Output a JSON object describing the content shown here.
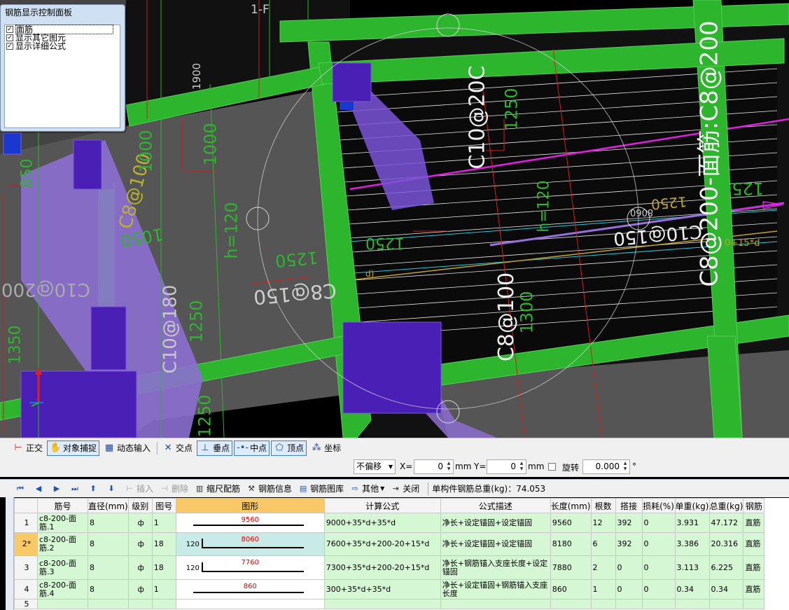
{
  "panel": {
    "title": "钢筋显示控制面板",
    "items": [
      {
        "label": "面筋",
        "checked": true
      },
      {
        "label": "显示其它图元",
        "checked": true
      },
      {
        "label": "显示详细公式",
        "checked": true
      }
    ]
  },
  "cad": {
    "labels": [
      "1-F",
      "1900",
      "C10@20C",
      "1250",
      "C8@200-面筋:C8@200",
      "1250",
      "850",
      "C8@100",
      "1000",
      "1000",
      "h=120",
      "1050",
      "1250",
      "C8@150",
      "C10@200",
      "C10@180",
      "1250",
      "1350",
      "1250",
      "h=120",
      "1250",
      "C10@150",
      "C8@100",
      "1300",
      "8060",
      "1250",
      "0+15*d",
      "d)"
    ]
  },
  "snapbar": {
    "buttons": [
      {
        "label": "正交",
        "icon": "ortho-icon",
        "on": false
      },
      {
        "label": "对象捕捉",
        "icon": "object-snap-icon",
        "on": true
      },
      {
        "label": "动态输入",
        "icon": "dynamic-input-icon",
        "on": false
      },
      {
        "label": "交点",
        "icon": "intersection-icon",
        "on": false
      },
      {
        "label": "垂点",
        "icon": "perpendicular-icon",
        "on": true
      },
      {
        "label": "中点",
        "icon": "midpoint-icon",
        "on": true
      },
      {
        "label": "顶点",
        "icon": "vertex-icon",
        "on": true
      },
      {
        "label": "坐标",
        "icon": "coordinate-icon",
        "on": false
      }
    ]
  },
  "coordbar": {
    "offset_mode": "不偏移",
    "x_label": "X=",
    "x_value": "0",
    "mm1": "mm",
    "y_label": "Y=",
    "y_value": "0",
    "mm2": "mm",
    "rotate_label": "旋转",
    "rotate_value": "0.000",
    "degree": "°"
  },
  "rebarbar": {
    "insert": "插入",
    "delete": "删除",
    "scale": "缩尺配筋",
    "info": "钢筋信息",
    "library": "钢筋图库",
    "other": "其他",
    "close": "关闭",
    "total": "单构件钢筋总重(kg)：74.053"
  },
  "table": {
    "headers": [
      "",
      "筋号",
      "直径(mm)",
      "级别",
      "图号",
      "图形",
      "计算公式",
      "公式描述",
      "长度(mm)",
      "根数",
      "搭接",
      "损耗(%)",
      "单重(kg)",
      "总重(kg)",
      "钢筋"
    ],
    "rows": [
      {
        "rn": "1",
        "name": "c8-200-面筋.1",
        "dia": "8",
        "grade": "ф",
        "fig": "1",
        "shape_len": "9560",
        "shape_left": "",
        "formula": "9000+35*d+35*d",
        "desc": "净长+设定锚固+设定锚固",
        "length": "9560",
        "count": "12",
        "lap": "392",
        "loss": "0",
        "unit": "3.931",
        "total": "47.172",
        "type": "直筋"
      },
      {
        "rn": "2*",
        "name": "c8-200-面筋.2",
        "dia": "8",
        "grade": "ф",
        "fig": "18",
        "shape_len": "8060",
        "shape_left": "120",
        "formula": "7600+35*d+200-20+15*d",
        "desc": "净长+设定锚固+设定锚固",
        "length": "8180",
        "count": "6",
        "lap": "392",
        "loss": "0",
        "unit": "3.386",
        "total": "20.316",
        "type": "直筋"
      },
      {
        "rn": "3",
        "name": "c8-200-面筋.3",
        "dia": "8",
        "grade": "ф",
        "fig": "18",
        "shape_len": "7760",
        "shape_left": "120",
        "formula": "7300+35*d+200-20+15*d",
        "desc": "净长+钢筋锚入支座长度+设定锚固",
        "length": "7880",
        "count": "2",
        "lap": "0",
        "loss": "0",
        "unit": "3.113",
        "total": "6.225",
        "type": "直筋"
      },
      {
        "rn": "4",
        "name": "c8-200-面筋.4",
        "dia": "8",
        "grade": "ф",
        "fig": "1",
        "shape_len": "860",
        "shape_left": "",
        "formula": "300+35*d+35*d",
        "desc": "净长+设定锚固+钢筋锚入支座长度",
        "length": "860",
        "count": "1",
        "lap": "0",
        "loss": "0",
        "unit": "0.34",
        "total": "0.34",
        "type": "直筋"
      },
      {
        "rn": "5",
        "name": "",
        "dia": "",
        "grade": "",
        "fig": "",
        "shape_len": "",
        "shape_left": "",
        "formula": "",
        "desc": "",
        "length": "",
        "count": "",
        "lap": "",
        "loss": "",
        "unit": "",
        "total": "",
        "type": ""
      }
    ]
  },
  "colors": {
    "beam_green": "#2db52d",
    "column_purple": "#4a1fb5",
    "slab_purple": "#8c6fd0",
    "dim_red": "#e03030",
    "rebar_magenta": "#e020e0",
    "grid_row_green": "#d5f7d3",
    "header_highlight": "#f9c967"
  }
}
